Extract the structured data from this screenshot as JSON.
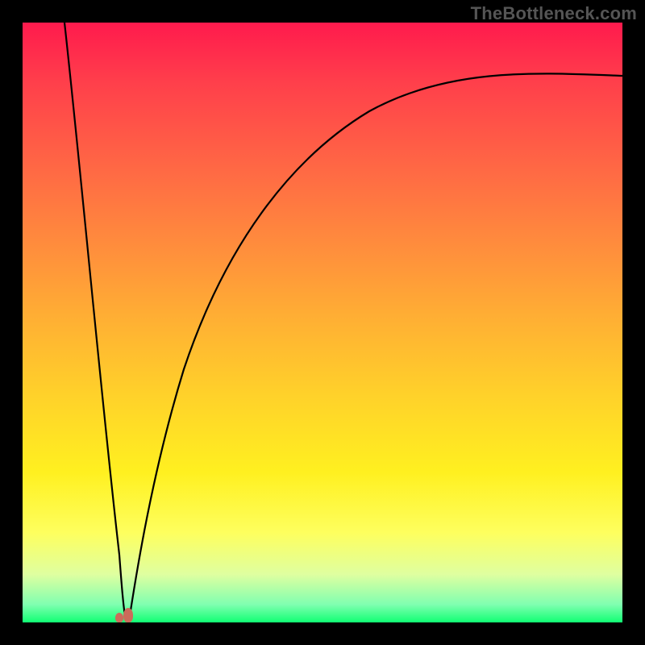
{
  "watermark": "TheBottleneck.com",
  "colors": {
    "frame": "#000000",
    "curve": "#000000",
    "nub": "#cc6b5a",
    "gradient_stops": [
      "#ff1a4d",
      "#ff6a44",
      "#ffb133",
      "#fff020",
      "#feff5e",
      "#11ff73"
    ]
  },
  "chart_data": {
    "type": "line",
    "title": "",
    "xlabel": "",
    "ylabel": "",
    "xlim": [
      0,
      100
    ],
    "ylim": [
      0,
      100
    ],
    "series": [
      {
        "name": "left-branch",
        "x": [
          7.0,
          8.0,
          9.0,
          10.0,
          11.0,
          12.5,
          14.0,
          15.5,
          16.8,
          17.2
        ],
        "values": [
          100,
          90,
          78,
          66,
          54,
          40,
          26,
          12,
          3,
          0
        ]
      },
      {
        "name": "right-branch",
        "x": [
          17.7,
          19.5,
          22.0,
          26.0,
          31.0,
          37.0,
          44.0,
          52.0,
          61.0,
          71.0,
          82.0,
          93.0,
          100.0
        ],
        "values": [
          0,
          10,
          22,
          37,
          50,
          61,
          70,
          77,
          82,
          86,
          89,
          90.5,
          91.0
        ]
      }
    ],
    "annotations": [
      {
        "name": "minimum-marker",
        "x": 17.3,
        "y": 0
      }
    ],
    "background": {
      "type": "vertical-gradient",
      "meaning": "red=high, green=low",
      "stops": [
        {
          "pos": 0.0,
          "color": "#ff1a4d"
        },
        {
          "pos": 0.5,
          "color": "#ffb133"
        },
        {
          "pos": 0.8,
          "color": "#fff020"
        },
        {
          "pos": 1.0,
          "color": "#11ff73"
        }
      ]
    }
  }
}
